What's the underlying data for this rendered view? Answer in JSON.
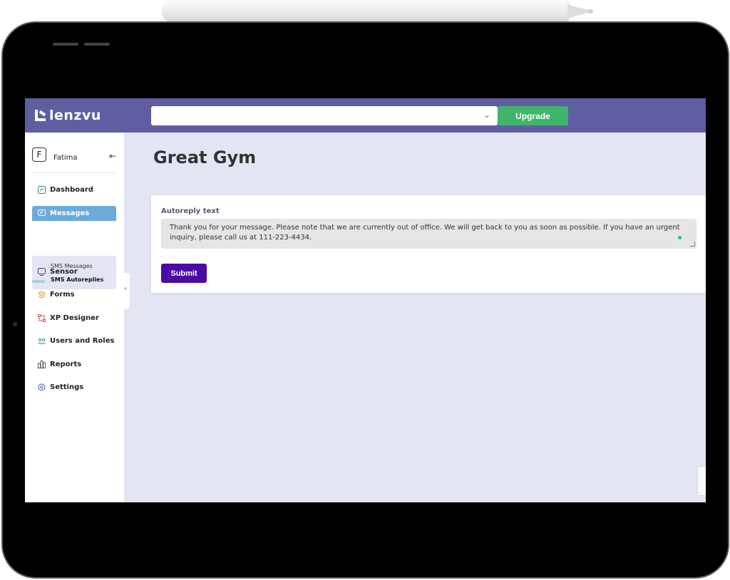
{
  "app": {
    "logo_text": "lenzvu"
  },
  "header": {
    "upgrade_label": "Upgrade",
    "select_value": ""
  },
  "user": {
    "initial": "F",
    "name": "Fatima"
  },
  "sidebar": {
    "items": [
      {
        "label": "Dashboard",
        "icon": "dashboard-icon"
      },
      {
        "label": "Messages",
        "icon": "message-icon"
      },
      {
        "label": "Sensor",
        "icon": "sensor-icon"
      },
      {
        "label": "Forms",
        "icon": "forms-icon"
      },
      {
        "label": "XP Designer",
        "icon": "designer-icon"
      },
      {
        "label": "Users and Roles",
        "icon": "users-icon"
      },
      {
        "label": "Reports",
        "icon": "reports-icon"
      },
      {
        "label": "Settings",
        "icon": "settings-icon"
      }
    ],
    "submenu": [
      {
        "label": "SMS Messages"
      },
      {
        "label": "SMS Autoreplies"
      }
    ]
  },
  "main": {
    "title": "Great Gym",
    "field_label": "Autoreply text",
    "autoreply_text": "Thank you for your message. Please note that we are currently out of office. We will get back to you as soon as possible. If you have an urgent inquiry, please call us at 111-223-4434.",
    "submit_label": "Submit"
  },
  "colors": {
    "topbar": "#5f5ea3",
    "upgrade": "#3fb56a",
    "submit": "#4a0aa3",
    "active_nav": "#6caad9",
    "background": "#e3e5f3"
  }
}
